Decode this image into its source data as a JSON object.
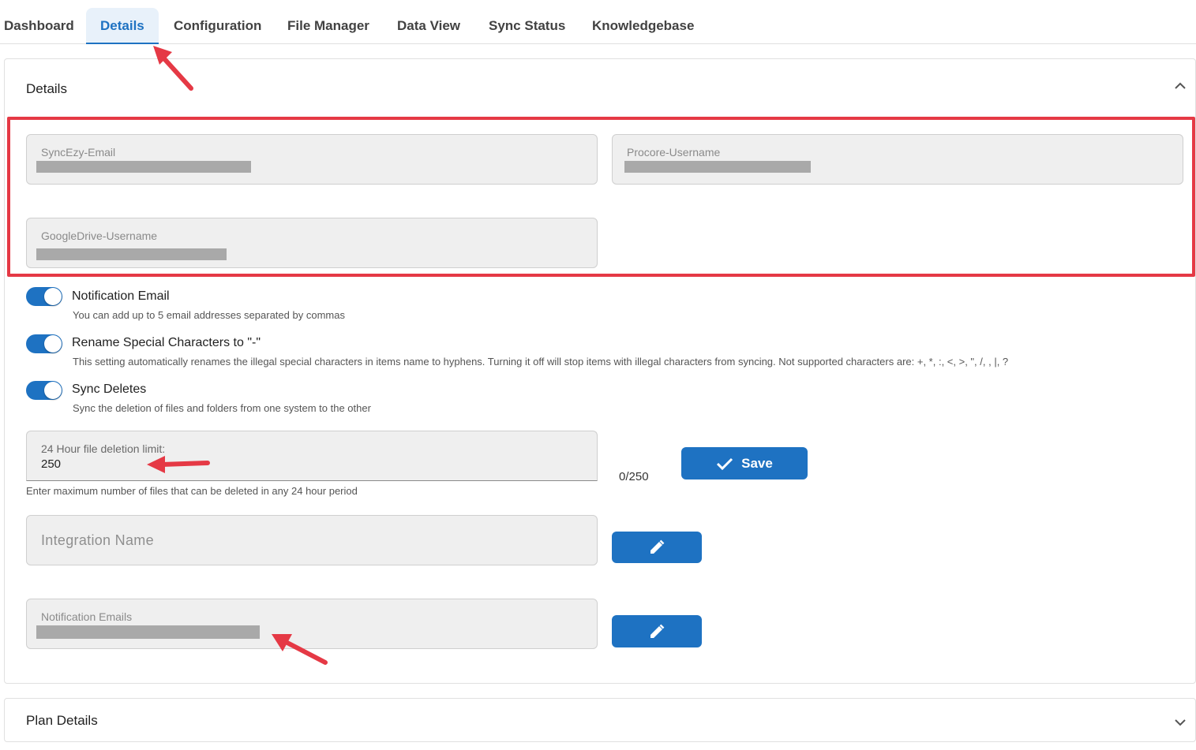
{
  "tabs": [
    {
      "label": "Dashboard"
    },
    {
      "label": "Details"
    },
    {
      "label": "Configuration"
    },
    {
      "label": "File Manager"
    },
    {
      "label": "Data View"
    },
    {
      "label": "Sync Status"
    },
    {
      "label": "Knowledgebase"
    }
  ],
  "active_tab": "Details",
  "details_panel": {
    "title": "Details",
    "fields": {
      "syncezy_email": {
        "label": "SyncEzy-Email"
      },
      "procore_username": {
        "label": "Procore-Username"
      },
      "googledrive_username": {
        "label": "GoogleDrive-Username"
      }
    },
    "options": [
      {
        "title": "Notification Email",
        "description": "You can add up to 5 email addresses separated by commas",
        "enabled": true
      },
      {
        "title": "Rename Special Characters to \"-\"",
        "description": "This setting automatically renames the illegal special characters in items name to hyphens. Turning it off will stop items with illegal characters from syncing. Not supported characters are: +, *, :, <, >, \", /, , |, ?",
        "enabled": true
      },
      {
        "title": "Sync Deletes",
        "description": "Sync the deletion of files and folders from one system to the other",
        "enabled": true
      }
    ],
    "deletion_limit": {
      "label": "24 Hour file deletion limit:",
      "value": "250",
      "counter": "0/250",
      "helper": "Enter maximum number of files that can be deleted in any 24 hour period",
      "save_label": "Save"
    },
    "integration_name": {
      "placeholder": "Integration Name"
    },
    "notification_emails": {
      "label": "Notification Emails"
    }
  },
  "plan_panel": {
    "title": "Plan Details"
  },
  "colors": {
    "primary": "#1e72c2",
    "annotation": "#e53945"
  }
}
